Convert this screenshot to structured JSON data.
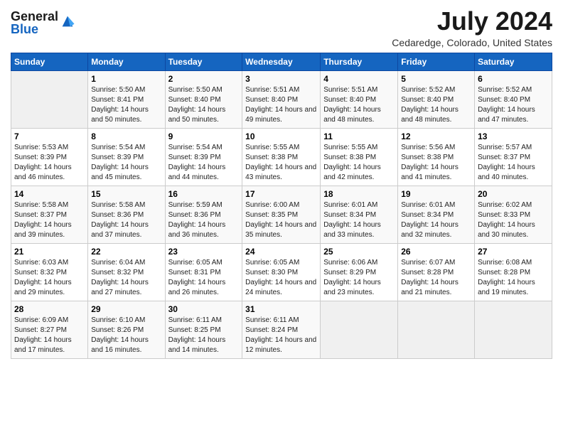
{
  "header": {
    "logo": {
      "general": "General",
      "blue": "Blue"
    },
    "title": "July 2024",
    "location": "Cedaredge, Colorado, United States"
  },
  "weekdays": [
    "Sunday",
    "Monday",
    "Tuesday",
    "Wednesday",
    "Thursday",
    "Friday",
    "Saturday"
  ],
  "weeks": [
    [
      {
        "day": "",
        "empty": true
      },
      {
        "day": "1",
        "sunrise": "Sunrise: 5:50 AM",
        "sunset": "Sunset: 8:41 PM",
        "daylight": "Daylight: 14 hours and 50 minutes."
      },
      {
        "day": "2",
        "sunrise": "Sunrise: 5:50 AM",
        "sunset": "Sunset: 8:40 PM",
        "daylight": "Daylight: 14 hours and 50 minutes."
      },
      {
        "day": "3",
        "sunrise": "Sunrise: 5:51 AM",
        "sunset": "Sunset: 8:40 PM",
        "daylight": "Daylight: 14 hours and 49 minutes."
      },
      {
        "day": "4",
        "sunrise": "Sunrise: 5:51 AM",
        "sunset": "Sunset: 8:40 PM",
        "daylight": "Daylight: 14 hours and 48 minutes."
      },
      {
        "day": "5",
        "sunrise": "Sunrise: 5:52 AM",
        "sunset": "Sunset: 8:40 PM",
        "daylight": "Daylight: 14 hours and 48 minutes."
      },
      {
        "day": "6",
        "sunrise": "Sunrise: 5:52 AM",
        "sunset": "Sunset: 8:40 PM",
        "daylight": "Daylight: 14 hours and 47 minutes."
      }
    ],
    [
      {
        "day": "7",
        "sunrise": "Sunrise: 5:53 AM",
        "sunset": "Sunset: 8:39 PM",
        "daylight": "Daylight: 14 hours and 46 minutes."
      },
      {
        "day": "8",
        "sunrise": "Sunrise: 5:54 AM",
        "sunset": "Sunset: 8:39 PM",
        "daylight": "Daylight: 14 hours and 45 minutes."
      },
      {
        "day": "9",
        "sunrise": "Sunrise: 5:54 AM",
        "sunset": "Sunset: 8:39 PM",
        "daylight": "Daylight: 14 hours and 44 minutes."
      },
      {
        "day": "10",
        "sunrise": "Sunrise: 5:55 AM",
        "sunset": "Sunset: 8:38 PM",
        "daylight": "Daylight: 14 hours and 43 minutes."
      },
      {
        "day": "11",
        "sunrise": "Sunrise: 5:55 AM",
        "sunset": "Sunset: 8:38 PM",
        "daylight": "Daylight: 14 hours and 42 minutes."
      },
      {
        "day": "12",
        "sunrise": "Sunrise: 5:56 AM",
        "sunset": "Sunset: 8:38 PM",
        "daylight": "Daylight: 14 hours and 41 minutes."
      },
      {
        "day": "13",
        "sunrise": "Sunrise: 5:57 AM",
        "sunset": "Sunset: 8:37 PM",
        "daylight": "Daylight: 14 hours and 40 minutes."
      }
    ],
    [
      {
        "day": "14",
        "sunrise": "Sunrise: 5:58 AM",
        "sunset": "Sunset: 8:37 PM",
        "daylight": "Daylight: 14 hours and 39 minutes."
      },
      {
        "day": "15",
        "sunrise": "Sunrise: 5:58 AM",
        "sunset": "Sunset: 8:36 PM",
        "daylight": "Daylight: 14 hours and 37 minutes."
      },
      {
        "day": "16",
        "sunrise": "Sunrise: 5:59 AM",
        "sunset": "Sunset: 8:36 PM",
        "daylight": "Daylight: 14 hours and 36 minutes."
      },
      {
        "day": "17",
        "sunrise": "Sunrise: 6:00 AM",
        "sunset": "Sunset: 8:35 PM",
        "daylight": "Daylight: 14 hours and 35 minutes."
      },
      {
        "day": "18",
        "sunrise": "Sunrise: 6:01 AM",
        "sunset": "Sunset: 8:34 PM",
        "daylight": "Daylight: 14 hours and 33 minutes."
      },
      {
        "day": "19",
        "sunrise": "Sunrise: 6:01 AM",
        "sunset": "Sunset: 8:34 PM",
        "daylight": "Daylight: 14 hours and 32 minutes."
      },
      {
        "day": "20",
        "sunrise": "Sunrise: 6:02 AM",
        "sunset": "Sunset: 8:33 PM",
        "daylight": "Daylight: 14 hours and 30 minutes."
      }
    ],
    [
      {
        "day": "21",
        "sunrise": "Sunrise: 6:03 AM",
        "sunset": "Sunset: 8:32 PM",
        "daylight": "Daylight: 14 hours and 29 minutes."
      },
      {
        "day": "22",
        "sunrise": "Sunrise: 6:04 AM",
        "sunset": "Sunset: 8:32 PM",
        "daylight": "Daylight: 14 hours and 27 minutes."
      },
      {
        "day": "23",
        "sunrise": "Sunrise: 6:05 AM",
        "sunset": "Sunset: 8:31 PM",
        "daylight": "Daylight: 14 hours and 26 minutes."
      },
      {
        "day": "24",
        "sunrise": "Sunrise: 6:05 AM",
        "sunset": "Sunset: 8:30 PM",
        "daylight": "Daylight: 14 hours and 24 minutes."
      },
      {
        "day": "25",
        "sunrise": "Sunrise: 6:06 AM",
        "sunset": "Sunset: 8:29 PM",
        "daylight": "Daylight: 14 hours and 23 minutes."
      },
      {
        "day": "26",
        "sunrise": "Sunrise: 6:07 AM",
        "sunset": "Sunset: 8:28 PM",
        "daylight": "Daylight: 14 hours and 21 minutes."
      },
      {
        "day": "27",
        "sunrise": "Sunrise: 6:08 AM",
        "sunset": "Sunset: 8:28 PM",
        "daylight": "Daylight: 14 hours and 19 minutes."
      }
    ],
    [
      {
        "day": "28",
        "sunrise": "Sunrise: 6:09 AM",
        "sunset": "Sunset: 8:27 PM",
        "daylight": "Daylight: 14 hours and 17 minutes."
      },
      {
        "day": "29",
        "sunrise": "Sunrise: 6:10 AM",
        "sunset": "Sunset: 8:26 PM",
        "daylight": "Daylight: 14 hours and 16 minutes."
      },
      {
        "day": "30",
        "sunrise": "Sunrise: 6:11 AM",
        "sunset": "Sunset: 8:25 PM",
        "daylight": "Daylight: 14 hours and 14 minutes."
      },
      {
        "day": "31",
        "sunrise": "Sunrise: 6:11 AM",
        "sunset": "Sunset: 8:24 PM",
        "daylight": "Daylight: 14 hours and 12 minutes."
      },
      {
        "day": "",
        "empty": true
      },
      {
        "day": "",
        "empty": true
      },
      {
        "day": "",
        "empty": true
      }
    ]
  ]
}
